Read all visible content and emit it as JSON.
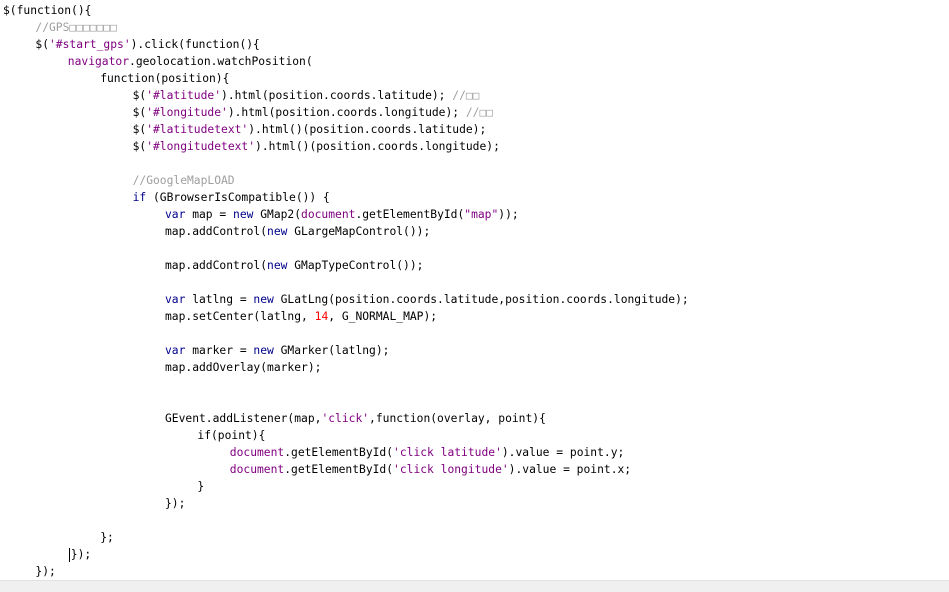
{
  "editor": {
    "colors": {
      "plain": "#000000",
      "string": "#800080",
      "keyword": "#00008b",
      "object": "#800080",
      "number": "#ff0000",
      "comment": "#9e9e9e",
      "scrollbar": "#f0f0f0"
    },
    "lines": [
      {
        "indent": 0,
        "tokens": [
          {
            "t": "$(function(){",
            "c": "plain"
          }
        ]
      },
      {
        "indent": 4,
        "tokens": [
          {
            "t": "//GPS□□□□□□□",
            "c": "cmt"
          }
        ]
      },
      {
        "indent": 4,
        "tokens": [
          {
            "t": "$(",
            "c": "plain"
          },
          {
            "t": "'#start_gps'",
            "c": "str"
          },
          {
            "t": ").click(function(){",
            "c": "plain"
          }
        ]
      },
      {
        "indent": 8,
        "tokens": [
          {
            "t": "navigator",
            "c": "obj"
          },
          {
            "t": ".geolocation.watchPosition(",
            "c": "plain"
          }
        ]
      },
      {
        "indent": 12,
        "tokens": [
          {
            "t": "function(position){",
            "c": "plain"
          }
        ]
      },
      {
        "indent": 16,
        "tokens": [
          {
            "t": "$(",
            "c": "plain"
          },
          {
            "t": "'#latitude'",
            "c": "str"
          },
          {
            "t": ").html(position.coords.latitude); ",
            "c": "plain"
          },
          {
            "t": "//□□",
            "c": "cmt"
          }
        ]
      },
      {
        "indent": 16,
        "tokens": [
          {
            "t": "$(",
            "c": "plain"
          },
          {
            "t": "'#longitude'",
            "c": "str"
          },
          {
            "t": ").html(position.coords.longitude); ",
            "c": "plain"
          },
          {
            "t": "//□□",
            "c": "cmt"
          }
        ]
      },
      {
        "indent": 16,
        "tokens": [
          {
            "t": "$(",
            "c": "plain"
          },
          {
            "t": "'#latitudetext'",
            "c": "str"
          },
          {
            "t": ").html()(position.coords.latitude);",
            "c": "plain"
          }
        ]
      },
      {
        "indent": 16,
        "tokens": [
          {
            "t": "$(",
            "c": "plain"
          },
          {
            "t": "'#longitudetext'",
            "c": "str"
          },
          {
            "t": ").html()(position.coords.longitude);",
            "c": "plain"
          }
        ]
      },
      {
        "indent": 0,
        "tokens": []
      },
      {
        "indent": 16,
        "tokens": [
          {
            "t": "//GoogleMapLOAD",
            "c": "cmt"
          }
        ]
      },
      {
        "indent": 16,
        "tokens": [
          {
            "t": "if",
            "c": "kw"
          },
          {
            "t": " (GBrowserIsCompatible()) {",
            "c": "plain"
          }
        ]
      },
      {
        "indent": 20,
        "tokens": [
          {
            "t": "var",
            "c": "kw"
          },
          {
            "t": " map = ",
            "c": "plain"
          },
          {
            "t": "new",
            "c": "kw"
          },
          {
            "t": " GMap2(",
            "c": "plain"
          },
          {
            "t": "document",
            "c": "obj"
          },
          {
            "t": ".getElementById(",
            "c": "plain"
          },
          {
            "t": "\"map\"",
            "c": "str"
          },
          {
            "t": "));",
            "c": "plain"
          }
        ]
      },
      {
        "indent": 20,
        "tokens": [
          {
            "t": "map.addControl(",
            "c": "plain"
          },
          {
            "t": "new",
            "c": "kw"
          },
          {
            "t": " GLargeMapControl());",
            "c": "plain"
          }
        ]
      },
      {
        "indent": 0,
        "tokens": []
      },
      {
        "indent": 20,
        "tokens": [
          {
            "t": "map.addControl(",
            "c": "plain"
          },
          {
            "t": "new",
            "c": "kw"
          },
          {
            "t": " GMapTypeControl());",
            "c": "plain"
          }
        ]
      },
      {
        "indent": 0,
        "tokens": []
      },
      {
        "indent": 20,
        "tokens": [
          {
            "t": "var",
            "c": "kw"
          },
          {
            "t": " latlng = ",
            "c": "plain"
          },
          {
            "t": "new",
            "c": "kw"
          },
          {
            "t": " GLatLng(position.coords.latitude,position.coords.longitude);",
            "c": "plain"
          }
        ]
      },
      {
        "indent": 20,
        "tokens": [
          {
            "t": "map.setCenter(latlng, ",
            "c": "plain"
          },
          {
            "t": "14",
            "c": "num"
          },
          {
            "t": ", G_NORMAL_MAP);",
            "c": "plain"
          }
        ]
      },
      {
        "indent": 0,
        "tokens": []
      },
      {
        "indent": 20,
        "tokens": [
          {
            "t": "var",
            "c": "kw"
          },
          {
            "t": " marker = ",
            "c": "plain"
          },
          {
            "t": "new",
            "c": "kw"
          },
          {
            "t": " GMarker(latlng);",
            "c": "plain"
          }
        ]
      },
      {
        "indent": 20,
        "tokens": [
          {
            "t": "map.addOverlay(marker);",
            "c": "plain"
          }
        ]
      },
      {
        "indent": 0,
        "tokens": []
      },
      {
        "indent": 0,
        "tokens": []
      },
      {
        "indent": 20,
        "tokens": [
          {
            "t": "GEvent.addListener(map,",
            "c": "plain"
          },
          {
            "t": "'click'",
            "c": "str"
          },
          {
            "t": ",function(overlay, point){",
            "c": "plain"
          }
        ]
      },
      {
        "indent": 24,
        "tokens": [
          {
            "t": "if(point){",
            "c": "plain"
          }
        ]
      },
      {
        "indent": 28,
        "tokens": [
          {
            "t": "document",
            "c": "obj"
          },
          {
            "t": ".getElementById(",
            "c": "plain"
          },
          {
            "t": "'click latitude'",
            "c": "str"
          },
          {
            "t": ").value = point.y;",
            "c": "plain"
          }
        ]
      },
      {
        "indent": 28,
        "tokens": [
          {
            "t": "document",
            "c": "obj"
          },
          {
            "t": ".getElementById(",
            "c": "plain"
          },
          {
            "t": "'click longitude'",
            "c": "str"
          },
          {
            "t": ").value = point.x;",
            "c": "plain"
          }
        ]
      },
      {
        "indent": 24,
        "tokens": [
          {
            "t": "}",
            "c": "plain"
          }
        ]
      },
      {
        "indent": 20,
        "tokens": [
          {
            "t": "});",
            "c": "plain"
          }
        ]
      },
      {
        "indent": 0,
        "tokens": []
      },
      {
        "indent": 12,
        "tokens": [
          {
            "t": "};",
            "c": "plain"
          }
        ]
      },
      {
        "indent": 8,
        "caret": true,
        "tokens": [
          {
            "t": "});",
            "c": "plain"
          }
        ]
      },
      {
        "indent": 4,
        "tokens": [
          {
            "t": "});",
            "c": "plain"
          }
        ]
      },
      {
        "indent": 0,
        "tokens": [
          {
            "t": "});",
            "c": "plain"
          }
        ]
      }
    ]
  }
}
